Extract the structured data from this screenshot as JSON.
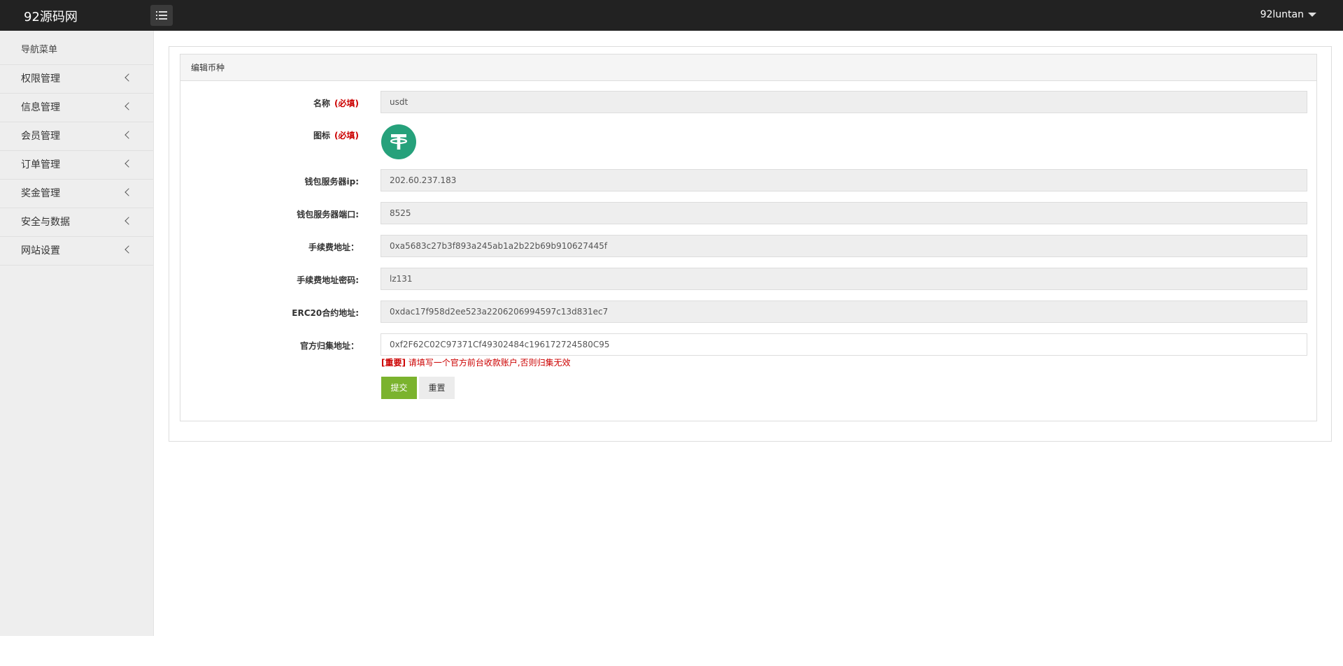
{
  "header": {
    "logo": "92源码网",
    "menu_toggle_icon": "list-icon",
    "user": "92luntan"
  },
  "sidebar": {
    "title": "导航菜单",
    "items": [
      {
        "label": "权限管理"
      },
      {
        "label": "信息管理"
      },
      {
        "label": "会员管理"
      },
      {
        "label": "订单管理"
      },
      {
        "label": "奖金管理"
      },
      {
        "label": "安全与数据"
      },
      {
        "label": "网站设置"
      }
    ]
  },
  "panel": {
    "title": "编辑币种",
    "fields": {
      "name": {
        "label": "名称",
        "required": "(必填)",
        "value": "usdt"
      },
      "icon": {
        "label": "图标",
        "required": "(必填)",
        "icon_name": "tether-icon",
        "icon_color": "#26a17b"
      },
      "wallet_ip": {
        "label": "钱包服务器ip:",
        "value": "202.60.237.183"
      },
      "wallet_port": {
        "label": "钱包服务器端口:",
        "value": "8525"
      },
      "fee_address": {
        "label": "手续费地址：",
        "value": "0xa5683c27b3f893a245ab1a2b22b69b910627445f"
      },
      "fee_password": {
        "label": "手续费地址密码:",
        "value": "lz131"
      },
      "erc20_contract": {
        "label": "ERC20合约地址:",
        "value": "0xdac17f958d2ee523a2206206994597c13d831ec7"
      },
      "collect_address": {
        "label": "官方归集地址：",
        "value": "0xf2F62C02C97371Cf49302484c196172724580C95"
      }
    },
    "hint": {
      "tag": "[重要]",
      "text": "请填写一个官方前台收款账户,否则归集无效"
    },
    "buttons": {
      "submit": "提交",
      "reset": "重置"
    }
  },
  "colors": {
    "topbar": "#222222",
    "submit": "#7bb32e",
    "required": "#cc0000"
  }
}
